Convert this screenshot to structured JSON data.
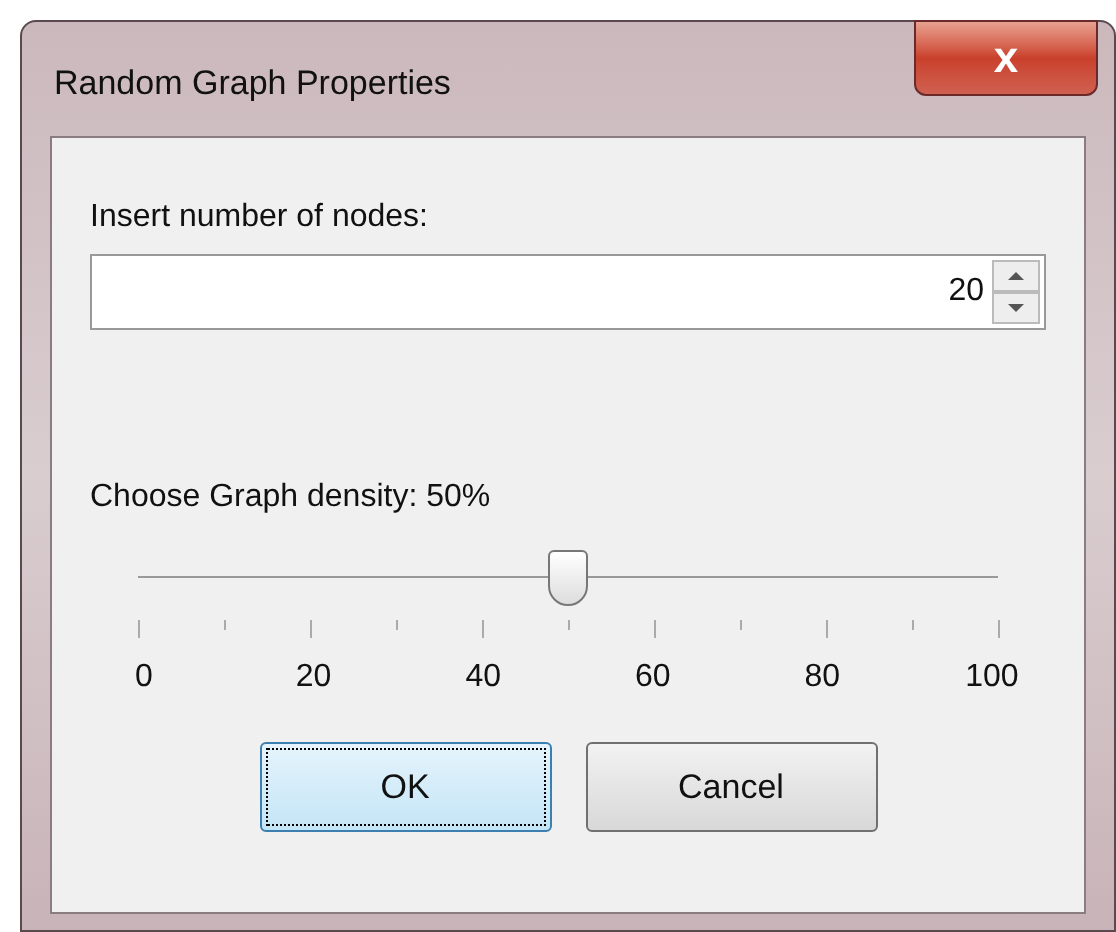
{
  "window": {
    "title": "Random Graph Properties",
    "close": "x"
  },
  "nodes": {
    "label": "Insert number of nodes:",
    "value": "20"
  },
  "density": {
    "label": "Choose Graph density: 50%",
    "level": 0.5,
    "tick_labels": [
      "0",
      "20",
      "40",
      "60",
      "80",
      "100"
    ]
  },
  "buttons": [
    {
      "label": "OK",
      "focused": true
    },
    {
      "label": "Cancel",
      "focused": false
    }
  ]
}
